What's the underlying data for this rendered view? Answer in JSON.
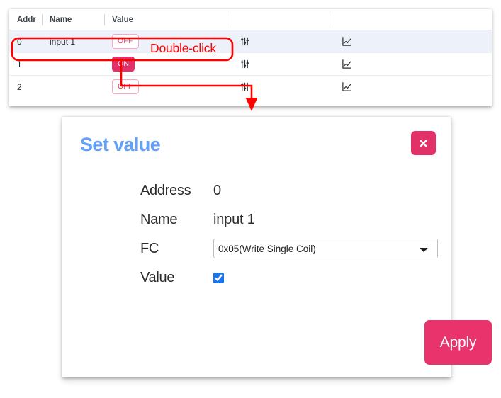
{
  "table": {
    "columns": [
      "Addr",
      "Name",
      "Value",
      "",
      ""
    ],
    "rows": [
      {
        "address": "0",
        "name": "input 1",
        "value": "OFF",
        "value_state": "off",
        "settings_icon": "sliders-icon",
        "chart_icon": "line-chart-icon",
        "selected": true
      },
      {
        "address": "1",
        "name": "",
        "value": "ON",
        "value_state": "on",
        "settings_icon": "sliders-icon",
        "chart_icon": "line-chart-icon",
        "selected": false
      },
      {
        "address": "2",
        "name": "",
        "value": "OFF",
        "value_state": "off",
        "settings_icon": "sliders-icon",
        "chart_icon": "line-chart-icon",
        "selected": false
      }
    ]
  },
  "annotation": {
    "label": "Double-click",
    "color": "#ff0000"
  },
  "dialog": {
    "title": "Set value",
    "title_color": "#63a0f7",
    "close_icon": "close-x-icon",
    "fields": {
      "address_label": "Address",
      "address_value": "0",
      "name_label": "Name",
      "name_value": "input 1",
      "fc_label": "FC",
      "fc_selected": "0x05(Write Single Coil)",
      "fc_options": [
        "0x05(Write Single Coil)"
      ],
      "value_label": "Value",
      "value_checked": true
    },
    "apply_label": "Apply",
    "accent_color": "#e8336d"
  }
}
